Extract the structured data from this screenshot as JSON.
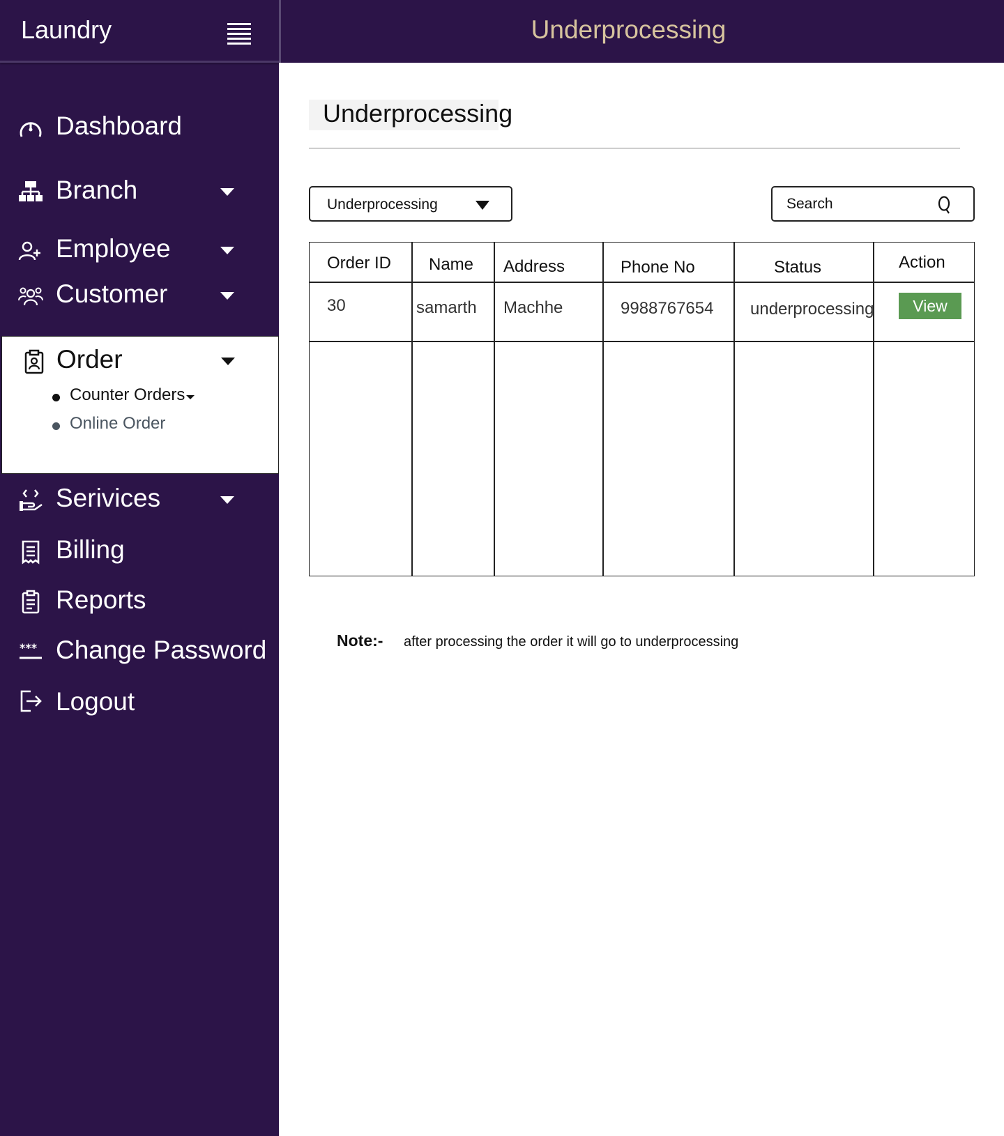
{
  "app": {
    "brand": "Laundry"
  },
  "header": {
    "title": "Underprocessing"
  },
  "sidebar": {
    "items": [
      {
        "label": "Dashboard",
        "icon": "dashboard-icon"
      },
      {
        "label": "Branch",
        "icon": "branch-icon"
      },
      {
        "label": "Employee",
        "icon": "employee-icon"
      },
      {
        "label": "Customer",
        "icon": "customer-icon"
      },
      {
        "label": "Order",
        "icon": "order-icon",
        "expanded": true,
        "children": [
          {
            "label": "Counter Orders"
          },
          {
            "label": "Online Order"
          }
        ]
      },
      {
        "label": "Serivices",
        "icon": "services-icon"
      },
      {
        "label": "Billing",
        "icon": "billing-icon"
      },
      {
        "label": "Reports",
        "icon": "reports-icon"
      },
      {
        "label": "Change Password",
        "icon": "password-icon"
      },
      {
        "label": "Logout",
        "icon": "logout-icon"
      }
    ]
  },
  "main": {
    "page_title": "Underprocessing",
    "filter": {
      "selected": "Underprocessing"
    },
    "search": {
      "placeholder": "Search"
    },
    "table": {
      "columns": [
        "Order ID",
        "Name",
        "Address",
        "Phone No",
        "Status",
        "Action"
      ],
      "rows": [
        {
          "order_id": "30",
          "name": "samarth",
          "address": "Machhe",
          "phone": "9988767654",
          "status": "underprocessing",
          "action": "View"
        }
      ]
    },
    "note": {
      "label": "Note:-",
      "text": "after processing the order it will go to underprocessing"
    }
  },
  "colors": {
    "sidebar_bg": "#2c1448",
    "header_title": "#d7c49e",
    "view_button": "#5a9a52",
    "sub_item_muted": "#4a5560"
  }
}
